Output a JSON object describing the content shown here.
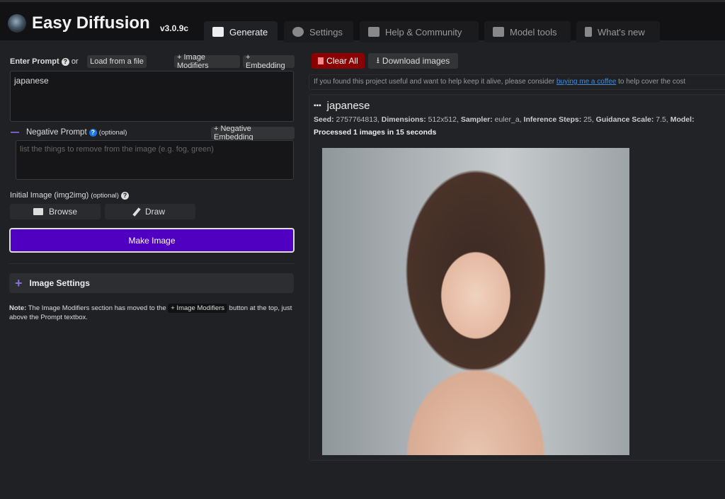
{
  "header": {
    "title": "Easy Diffusion",
    "version": "v3.0.9c",
    "tabs": [
      {
        "label": "Generate",
        "icon": "image-icon"
      },
      {
        "label": "Settings",
        "icon": "gear-icon"
      },
      {
        "label": "Help & Community",
        "icon": "comments-icon"
      },
      {
        "label": "Model tools",
        "icon": "toolbox-icon"
      },
      {
        "label": "What's new",
        "icon": "bolt-icon"
      }
    ]
  },
  "prompt": {
    "label": "Enter Prompt",
    "or": "or",
    "load": "Load from a file",
    "modifiers": "+ Image Modifiers",
    "embedding": "+ Embedding",
    "value": "japanese"
  },
  "negative": {
    "label": "Negative Prompt",
    "optional": "(optional)",
    "embedding": "+ Negative Embedding",
    "placeholder": "list the things to remove from the image (e.g. fog, green)"
  },
  "init": {
    "label": "Initial Image (img2img)",
    "optional": "(optional)",
    "browse": "Browse",
    "draw": "Draw"
  },
  "make": "Make Image",
  "image_settings": "Image Settings",
  "note": {
    "bold": "Note:",
    "text1": " The Image Modifiers section has moved to the ",
    "chip": "+ Image Modifiers",
    "text2": " button at the top, just above the Prompt textbox."
  },
  "actions": {
    "clear": "Clear All",
    "download": "Download images"
  },
  "support": {
    "text1": "If you found this project useful and want to help keep it alive, please consider ",
    "link": "buying me a coffee",
    "text2": " to help cover the cost"
  },
  "result": {
    "title": "japanese",
    "seed_l": "Seed:",
    "seed": " 2757764813, ",
    "dim_l": "Dimensions:",
    "dim": " 512x512, ",
    "sampler_l": "Sampler:",
    "sampler": " euler_a, ",
    "steps_l": "Inference Steps:",
    "steps": " 25, ",
    "guid_l": "Guidance Scale:",
    "guid": " 7.5, ",
    "model_l": "Model:",
    "processed": "Processed 1 images in 15 seconds"
  },
  "colors": {
    "accent": "#5000c0",
    "danger": "#8b0000",
    "link": "#3a8ee6"
  }
}
